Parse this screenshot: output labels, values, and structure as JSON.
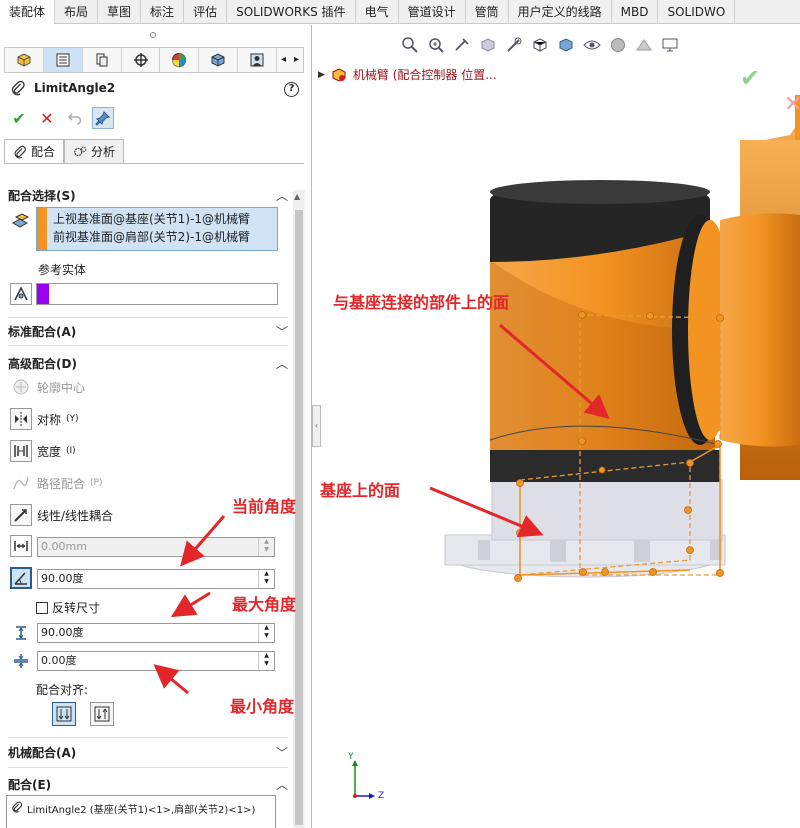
{
  "tabs": [
    "装配体",
    "布局",
    "草图",
    "标注",
    "评估",
    "SOLIDWORKS 插件",
    "电气",
    "管道设计",
    "管筒",
    "用户定义的线路",
    "MBD",
    "SOLIDWO"
  ],
  "property_manager": {
    "title": "LimitAngle2",
    "help": "?",
    "actions": {
      "ok": "✔",
      "cancel": "✕"
    },
    "subtabs": [
      {
        "label": "配合"
      },
      {
        "label": "分析"
      }
    ]
  },
  "mate_selection": {
    "header": "配合选择(S)",
    "items": [
      "上视基准面@基座(关节1)-1@机械臂",
      "前视基准面@肩部(关节2)-1@机械臂"
    ],
    "reference_entity_label": "参考实体"
  },
  "sections": {
    "standard": "标准配合(A)",
    "advanced": "高级配合(D)",
    "mechanical": "机械配合(A)",
    "mates": "配合(E)"
  },
  "advanced": {
    "profile_center": "轮廓中心",
    "symmetric": "对称",
    "symmetric_key": "(Y)",
    "width": "宽度",
    "width_key": "(I)",
    "path_mate": "路径配合",
    "path_key": "(P)",
    "linear_coupler": "线性/线性耦合",
    "distance_value": "0.00mm",
    "current_angle": "90.00度",
    "flip_dimension": "反转尺寸",
    "max_angle": "90.00度",
    "min_angle": "0.00度",
    "mate_alignment": "配合对齐:"
  },
  "mates_list": {
    "item": "LimitAngle2 (基座(关节1)<1>,肩部(关节2)<1>)"
  },
  "annotations": {
    "current_angle": "当前角度",
    "max_angle": "最大角度",
    "min_angle": "最小角度",
    "face_on_connected_part": "与基座连接的部件上的面",
    "face_on_base": "基座上的面"
  },
  "viewport": {
    "tree_label": "机械臂 (配合控制器 位置...",
    "triad": {
      "y": "Y",
      "z": "Z"
    }
  },
  "colors": {
    "accent_orange": "#f29322",
    "annotation_red": "#e3262a",
    "selection_blue": "#cfe3f5",
    "reference_purple": "#9b00f2"
  }
}
